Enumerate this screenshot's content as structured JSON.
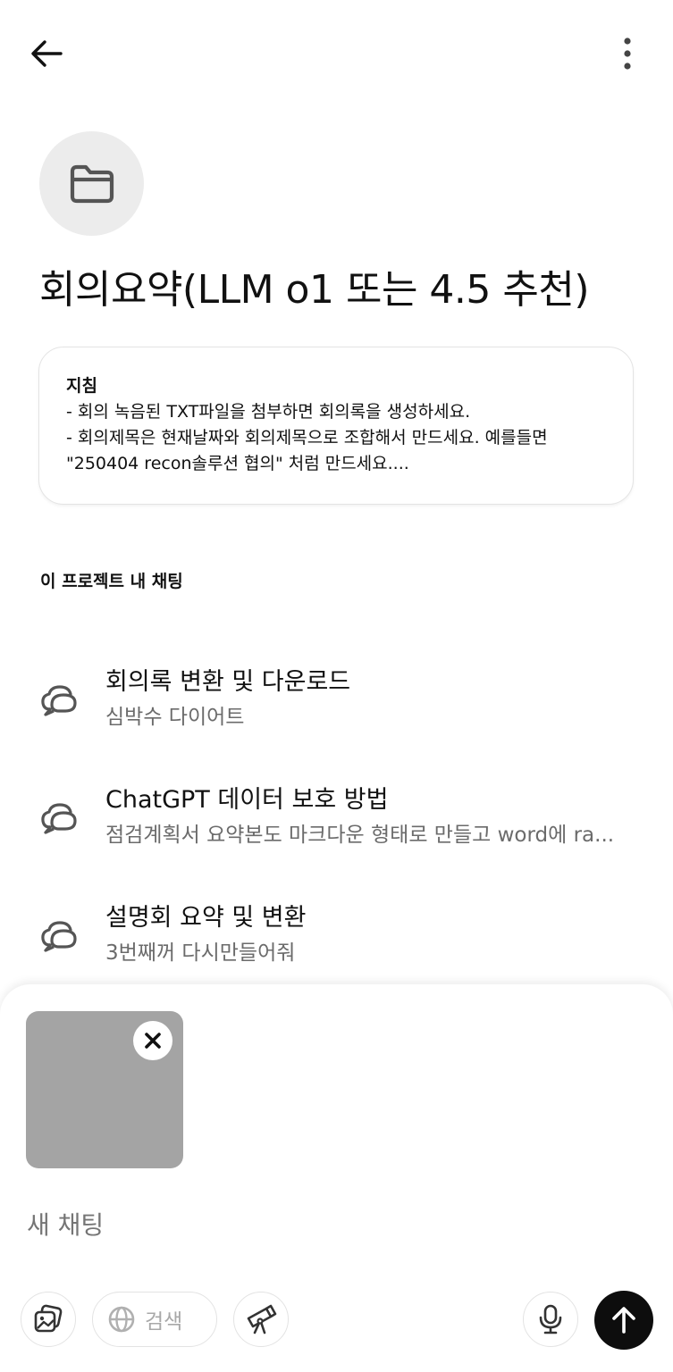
{
  "header": {
    "back_icon": "arrow-left-icon",
    "more_icon": "more-vertical-icon"
  },
  "project": {
    "icon": "folder-icon",
    "title": "회의요약(LLM o1 또는 4.5 추천)"
  },
  "instructions": {
    "heading": "지침",
    "lines": [
      "- 회의 녹음된 TXT파일을 첨부하면 회의록을 생성하세요.",
      "- 회의제목은 현재날짜와 회의제목으로 조합해서 만드세요. 예를들면",
      "\"250404 recon솔루션 협의\" 처럼 만드세요...."
    ]
  },
  "section": {
    "label": "이 프로젝트 내 채팅"
  },
  "chats": [
    {
      "title": "회의록 변환 및 다운로드",
      "subtitle": "심박수 다이어트",
      "icon": "chat-bubbles-icon"
    },
    {
      "title": "ChatGPT 데이터 보호 방법",
      "subtitle": "점검계획서 요약본도 마크다운 형태로 만들고 word에 ra...",
      "icon": "chat-bubbles-icon"
    },
    {
      "title": "설명회 요약 및 변환",
      "subtitle": "3번째꺼 다시만들어줘",
      "icon": "chat-bubbles-icon"
    }
  ],
  "composer": {
    "placeholder": "새 채팅",
    "remove_icon": "close-icon",
    "tools": {
      "image_icon": "image-upload-icon",
      "search_icon": "globe-icon",
      "search_label": "검색",
      "research_icon": "telescope-icon",
      "mic_icon": "microphone-icon",
      "send_icon": "arrow-up-icon"
    }
  },
  "colors": {
    "avatar_bg": "#ececec",
    "attachment_bg": "#a4a4a4",
    "send_button": "#0d0d0d",
    "secondary_text": "#6b6b6b"
  }
}
